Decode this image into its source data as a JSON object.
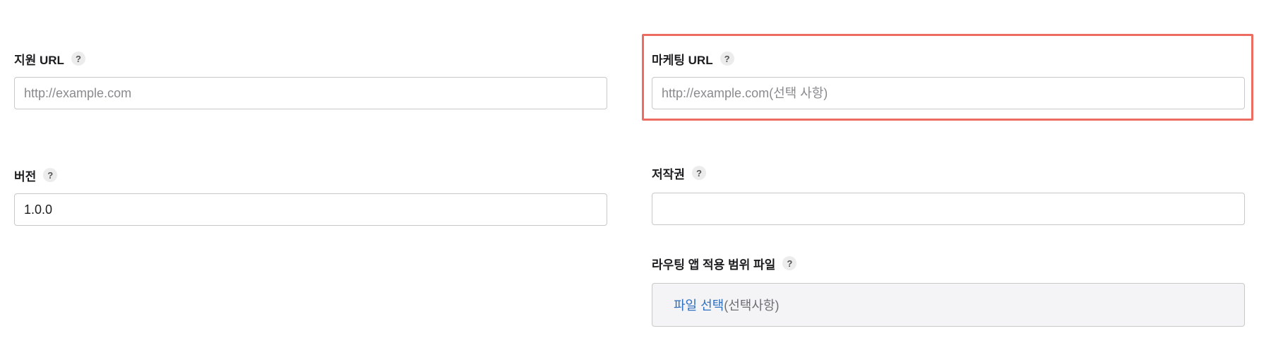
{
  "support_url": {
    "label": "지원 URL",
    "help": "?",
    "placeholder": "http://example.com",
    "value": ""
  },
  "marketing_url": {
    "label": "마케팅 URL",
    "help": "?",
    "placeholder": "http://example.com(선택 사항)",
    "value": ""
  },
  "version": {
    "label": "버전",
    "help": "?",
    "value": "1.0.0"
  },
  "copyright": {
    "label": "저작권",
    "help": "?",
    "value": ""
  },
  "routing_file": {
    "label": "라우팅 앱 적용 범위 파일",
    "help": "?",
    "link_text": "파일 선택",
    "optional_text": "(선택사항)"
  },
  "colors": {
    "highlight": "#ec6c62",
    "link": "#2e6fc0",
    "input_border": "#c8c8c8",
    "file_box_bg": "#f4f4f6"
  },
  "icons": {
    "help": "question-mark-circle-icon"
  }
}
